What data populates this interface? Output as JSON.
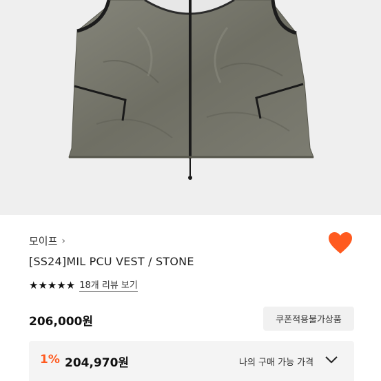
{
  "product": {
    "brand": "모이프",
    "brand_chevron": "›",
    "title": "[SS24]MIL PCU VEST / STONE",
    "stars": "★★★★★",
    "review_link": "18개 리뷰 보기",
    "price": "206,000원",
    "coupon_label": "쿠폰적용불가상품",
    "my_price": {
      "discount": "1%",
      "value": "204,970원",
      "label": "나의 구매 가능 가격"
    }
  },
  "colors": {
    "accent": "#ff5a1f",
    "heart": "#ff5a1f",
    "hero_bg": "#efefef",
    "vest": "#77776c"
  },
  "icons": {
    "wishlist": "heart-icon",
    "brand_link": "chevron-right-icon",
    "expand": "chevron-down-icon"
  }
}
